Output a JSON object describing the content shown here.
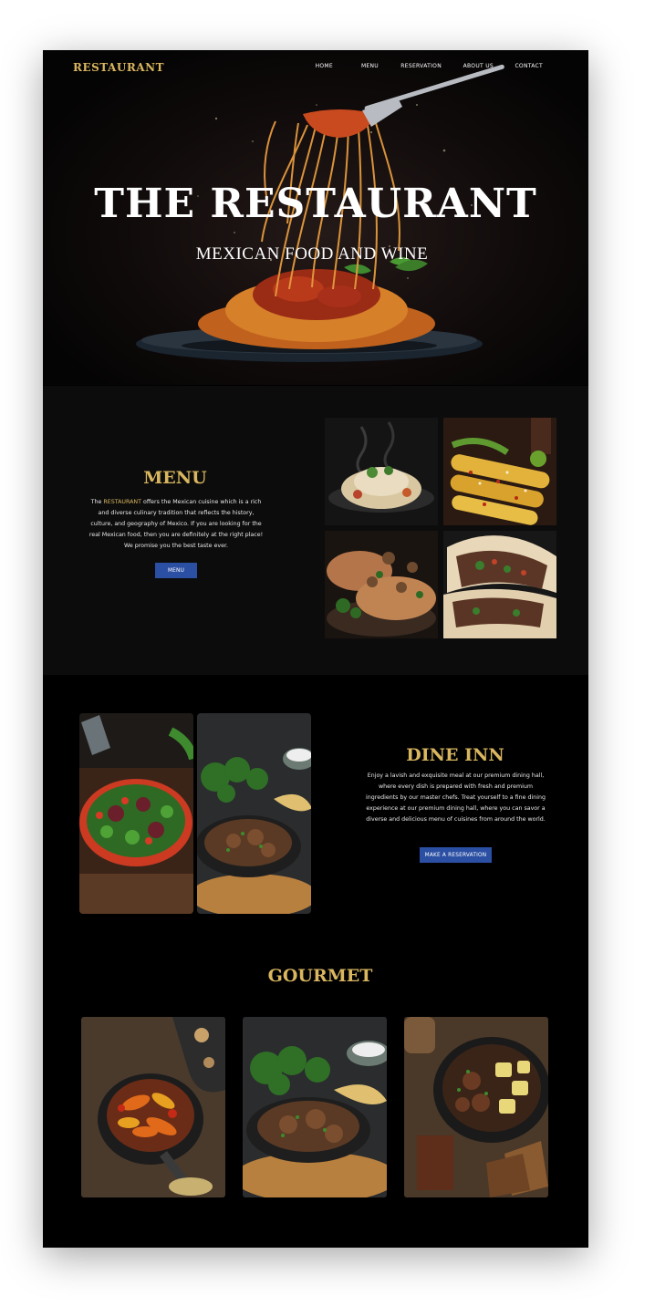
{
  "header": {
    "logo": "RESTAURANT",
    "nav": [
      "HOME",
      "MENU",
      "RESERVATION",
      "ABOUT US",
      "CONTACT"
    ]
  },
  "hero": {
    "title": "THE RESTAURANT",
    "subtitle": "MEXICAN FOOD AND WINE"
  },
  "menu_section": {
    "title": "MENU",
    "text_prefix": "The ",
    "text_highlight": "RESTAURANT",
    "text_body": " offers the Mexican cuisine which is a rich and diverse culinary tradition that reflects the history, culture, and geography of Mexico. If you are looking for the real Mexican food, then you are definitely at the right place! We promise you the best taste ever.",
    "button": "MENU"
  },
  "dine_section": {
    "title": "DINE INN",
    "text": "Enjoy a lavish and exquisite meal at our premium dining hall, where every dish is prepared with fresh and premium ingredients by our master chefs. Treat yourself to a fine dining experience at our premium dining hall, where you can savor a diverse and delicious menu of cuisines from around the world.",
    "button": "MAKE A RESERVATION"
  },
  "gourmet_section": {
    "title": "GOURMET"
  },
  "colors": {
    "accent_gold": "#d9b65f",
    "button_blue": "#2b4fa3",
    "background": "#000000",
    "section_dark": "#0c0c0c"
  }
}
